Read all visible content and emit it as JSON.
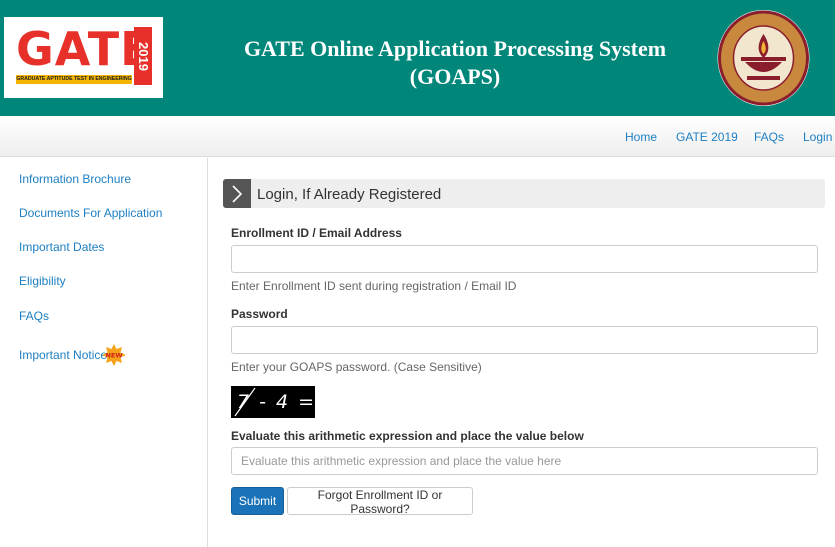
{
  "header": {
    "logo": {
      "word": "GATE",
      "year": "2019",
      "tagline": "GRADUATE APTITUDE TEST IN ENGINEERING"
    },
    "title_line1": "GATE Online Application Processing System",
    "title_line2": "(GOAPS)",
    "seal_text": "INDIAN INSTITUTE OF TECHNOLOGY MADRAS"
  },
  "nav": {
    "home": "Home",
    "gate2019": "GATE 2019",
    "faqs": "FAQs",
    "login": "Login"
  },
  "sidebar": {
    "items": [
      {
        "label": "Information Brochure"
      },
      {
        "label": "Documents For Application"
      },
      {
        "label": "Important Dates"
      },
      {
        "label": "Eligibility"
      },
      {
        "label": "FAQs"
      },
      {
        "label": "Important Notice"
      }
    ],
    "new_badge": "NEW"
  },
  "login": {
    "heading": "Login, If Already Registered",
    "enrollment": {
      "label": "Enrollment ID / Email Address",
      "value": "",
      "help": "Enter Enrollment ID sent during registration / Email ID"
    },
    "password": {
      "label": "Password",
      "value": "",
      "help": "Enter your GOAPS password. (Case Sensitive)"
    },
    "captcha": {
      "expression": "7 - 4 ="
    },
    "arithmetic": {
      "label": "Evaluate this arithmetic expression and place the value below",
      "placeholder": "Evaluate this arithmetic expression and place the value here"
    },
    "submit_label": "Submit",
    "forgot_label": "Forgot Enrollment ID or Password?"
  },
  "colors": {
    "header_bg": "#00877a",
    "link": "#1d7fc2",
    "primary_button": "#1a73b8",
    "logo_red": "#e8302a",
    "seal_maroon": "#8b1e2d"
  }
}
